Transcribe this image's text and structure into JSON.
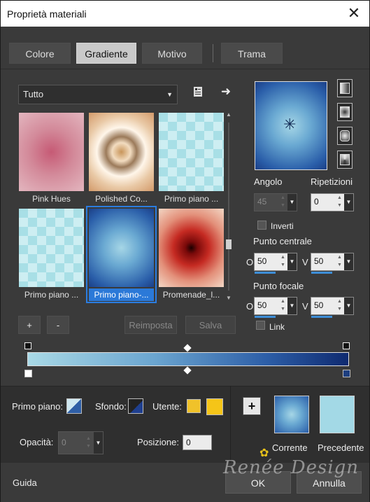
{
  "window": {
    "title": "Proprietà materiali"
  },
  "tabs": [
    {
      "label": "Colore",
      "active": false
    },
    {
      "label": "Gradiente",
      "active": true
    },
    {
      "label": "Motivo",
      "active": false
    },
    {
      "label": "Trama",
      "active": false
    }
  ],
  "library": {
    "filter_value": "Tutto",
    "items": [
      {
        "label": "Pink Hues",
        "selected": false
      },
      {
        "label": "Polished Co...",
        "selected": false
      },
      {
        "label": "Primo piano ...",
        "selected": false
      },
      {
        "label": "Primo piano ...",
        "selected": false
      },
      {
        "label": "Primo piano-...",
        "selected": true
      },
      {
        "label": "Promenade_l...",
        "selected": false
      }
    ],
    "add_label": "+",
    "remove_label": "-",
    "reset_label": "Reimposta",
    "save_label": "Salva"
  },
  "gradient": {
    "angle_label": "Angolo",
    "angle_value": "45",
    "repeats_label": "Ripetizioni",
    "repeats_value": "0",
    "invert_label": "Inverti",
    "invert_checked": false,
    "center_label": "Punto centrale",
    "center_h_letter": "O",
    "center_h_value": "50",
    "center_v_letter": "V",
    "center_v_value": "50",
    "focal_label": "Punto focale",
    "focal_h_letter": "O",
    "focal_h_value": "50",
    "focal_v_letter": "V",
    "focal_v_value": "50",
    "link_label": "Link",
    "link_checked": false
  },
  "materials": {
    "foreground_label": "Primo piano:",
    "background_label": "Sfondo:",
    "user_label": "Utente:",
    "user_color_1": "#f0c22a",
    "user_color_2": "#f5c518",
    "opacity_label": "Opacità:",
    "opacity_value": "0",
    "position_label": "Posizione:",
    "position_value": "0",
    "current_label": "Corrente",
    "previous_label": "Precedente",
    "previous_color": "#a3d9e6"
  },
  "footer": {
    "help_label": "Guida",
    "ok_label": "OK",
    "cancel_label": "Annulla"
  },
  "icons": {
    "close": "close-icon",
    "caret": "chevron-down-icon",
    "library_menu": "library-icon",
    "arrow": "arrow-right-icon"
  },
  "watermark": "Renée Design"
}
